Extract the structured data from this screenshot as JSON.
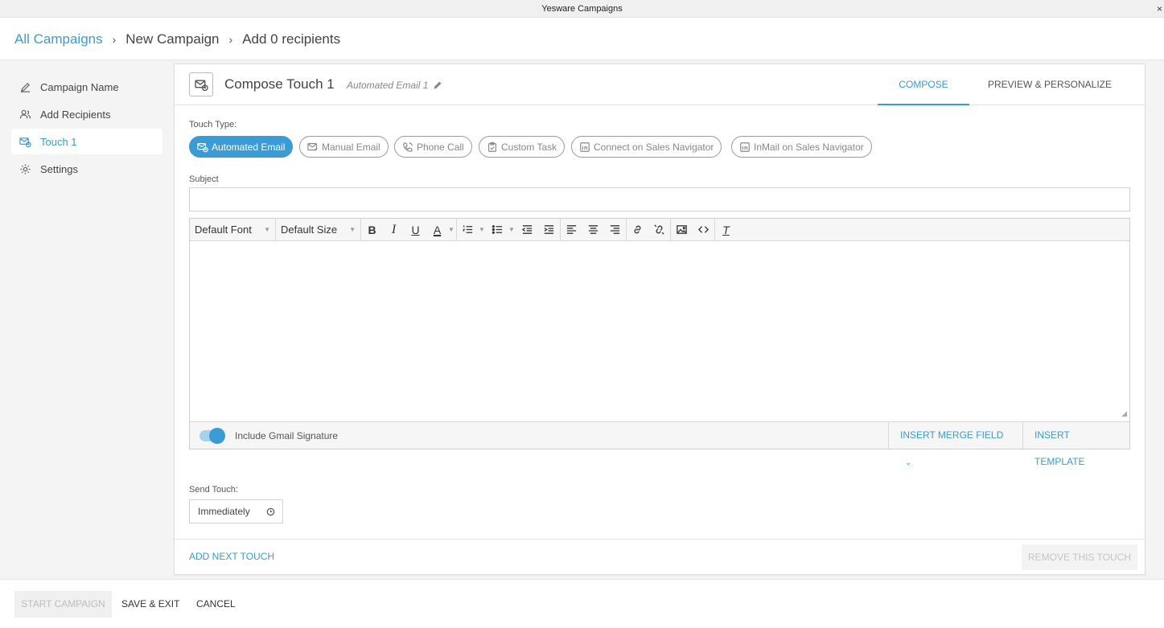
{
  "window": {
    "title": "Yesware Campaigns",
    "close_glyph": "×"
  },
  "breadcrumb": {
    "items": [
      "All Campaigns",
      "New Campaign",
      "Add 0 recipients"
    ],
    "separator": "›"
  },
  "sidebar": {
    "items": [
      {
        "label": "Campaign Name",
        "icon": "pencil-icon",
        "active": false
      },
      {
        "label": "Add Recipients",
        "icon": "users-icon",
        "active": false
      },
      {
        "label": "Touch 1",
        "icon": "email-clock-icon",
        "active": true
      },
      {
        "label": "Settings",
        "icon": "gear-icon",
        "active": false
      }
    ]
  },
  "compose": {
    "title": "Compose Touch 1",
    "subtitle": "Automated Email 1",
    "tabs": [
      "COMPOSE",
      "PREVIEW & PERSONALIZE"
    ],
    "active_tab": "COMPOSE",
    "touch_type_label": "Touch Type:",
    "touch_types": [
      {
        "label": "Automated Email",
        "icon": "email-clock-icon",
        "active": true
      },
      {
        "label": "Manual Email",
        "icon": "email-hand-icon",
        "active": false
      },
      {
        "label": "Phone Call",
        "icon": "phone-icon",
        "active": false
      },
      {
        "label": "Custom Task",
        "icon": "clipboard-icon",
        "active": false
      },
      {
        "label": "Connect on Sales Navigator",
        "icon": "linkedin-icon",
        "active": false
      },
      {
        "label": "InMail on Sales Navigator",
        "icon": "linkedin-icon",
        "active": false
      }
    ],
    "subject_label": "Subject",
    "subject_value": "",
    "toolbar": {
      "font": "Default Font",
      "size": "Default Size",
      "bold": "B",
      "italic": "I",
      "underline": "U",
      "color": "A",
      "clear_format": "T"
    },
    "editor_footer": {
      "signature_label": "Include Gmail Signature",
      "signature_on": true,
      "merge_field": "INSERT MERGE FIELD",
      "insert_template": "INSERT TEMPLATE"
    },
    "send_touch_label": "Send Touch:",
    "send_touch_value": "Immediately",
    "add_next": "ADD NEXT TOUCH",
    "remove": "REMOVE THIS TOUCH"
  },
  "footer": {
    "start": "START CAMPAIGN",
    "save_exit": "SAVE & EXIT",
    "cancel": "CANCEL"
  },
  "colors": {
    "accent": "#3a9bd5",
    "sidebar_bg": "#f4f4f4"
  }
}
